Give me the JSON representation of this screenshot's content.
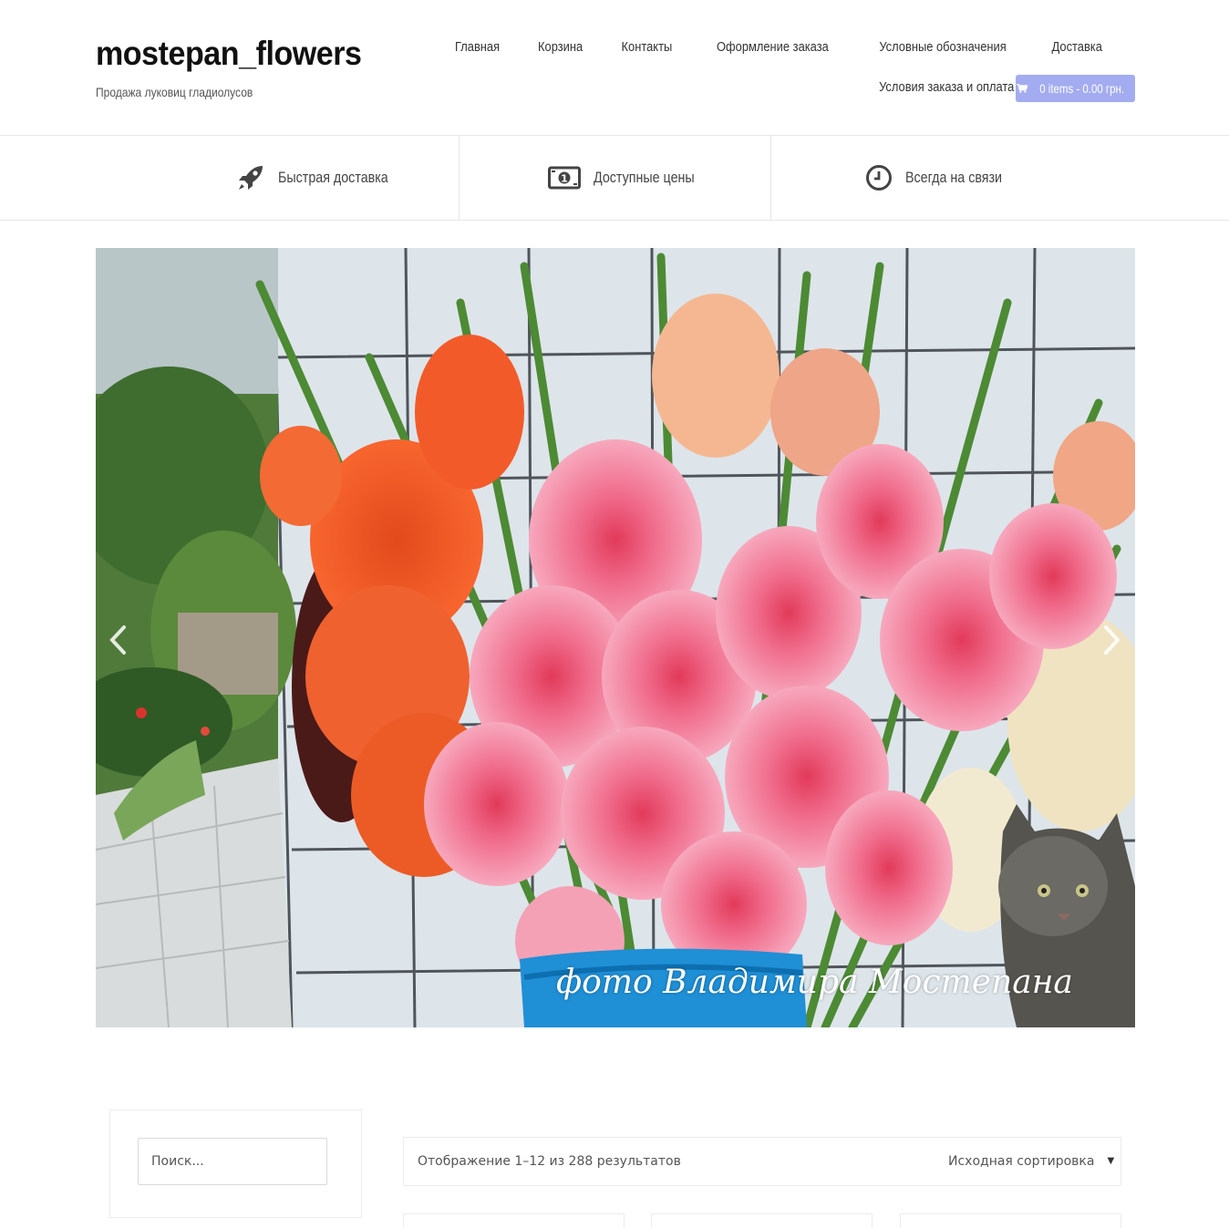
{
  "site": {
    "title": "mostepan_flowers",
    "tagline": "Продажа луковиц гладиолусов"
  },
  "nav": {
    "row1": [
      "Главная",
      "Корзина",
      "Контакты",
      "Оформление заказа",
      "Условные обозначения",
      "Доставка"
    ],
    "row2": [
      "Условия заказа и оплата"
    ],
    "cart_label": "0 items - 0.00 грн.",
    "cart_icon": "shopping-cart-icon",
    "cart_color": "#a3acf0"
  },
  "features": [
    {
      "label": "Быстрая доставка",
      "icon": "rocket-icon"
    },
    {
      "label": "Доступные цены",
      "icon": "money-icon"
    },
    {
      "label": "Всегда на связи",
      "icon": "clock-icon"
    }
  ],
  "slider": {
    "caption": "фото Владимира Мостепана",
    "prev_icon": "chevron-left-icon",
    "next_icon": "chevron-right-icon"
  },
  "sidebar": {
    "search_placeholder": "Поиск..."
  },
  "shop": {
    "result_count": "Отображение 1–12 из 288 результатов",
    "orderby_selected": "Исходная сортировка"
  }
}
